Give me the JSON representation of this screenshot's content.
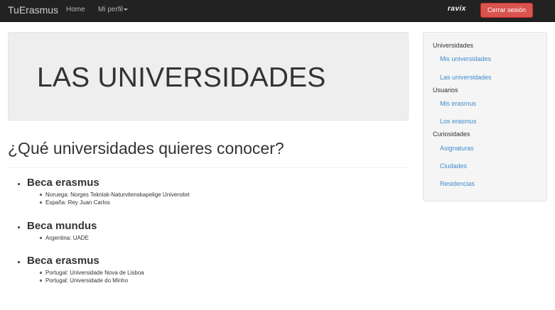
{
  "navbar": {
    "brand": "TuErasmus",
    "home_label": "Home",
    "profile_label": "Mi perfil",
    "user_label": "ravix",
    "logout_label": "Cerrar sesión"
  },
  "main": {
    "jumbotron_title": "LAS UNIVERSIDADES",
    "question": "¿Qué universidades quieres conocer?",
    "becas": [
      {
        "title": "Beca erasmus",
        "items": [
          "Noruega: Norges Teknisk-Naturvitenskapelige Universitet",
          "España: Rey Juan Carlos"
        ]
      },
      {
        "title": "Beca mundus",
        "items": [
          "Argentina: UADE"
        ]
      },
      {
        "title": "Beca erasmus",
        "items": [
          "Portugal: Universidade Nova de Lisboa",
          "Portugal: Universidade do Minho"
        ]
      }
    ]
  },
  "sidebar": {
    "sections": [
      {
        "header": "Universidades",
        "links": [
          "Mis universidades",
          "Las universidades"
        ]
      },
      {
        "header": "Usuarios",
        "links": [
          "Mis erasmus",
          "Los erasmus"
        ]
      },
      {
        "header": "Curiosidades",
        "links": [
          "Asignaturas",
          "Ciudades",
          "Residencias"
        ]
      }
    ]
  },
  "colors": {
    "navbar_bg": "#222222",
    "danger_button": "#d9534f",
    "link": "#428bca",
    "jumbotron_bg": "#eeeeee",
    "sidebar_bg": "#f5f5f5"
  }
}
